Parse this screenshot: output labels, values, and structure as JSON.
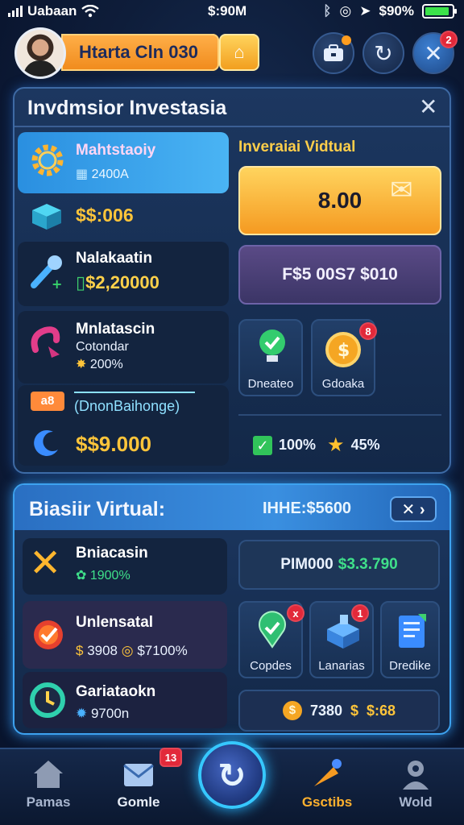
{
  "status_bar": {
    "carrier": "Uabaan",
    "time": "$:90M",
    "battery": "$90%",
    "battery_level": 0.9
  },
  "header": {
    "player_name": "Htarta Cln 030",
    "avatar_icon": "player-portrait",
    "action_icon": "home-icon",
    "buttons": [
      {
        "icon": "toolbox-icon"
      },
      {
        "icon": "refresh-icon"
      },
      {
        "icon": "close-icon",
        "badge": "2"
      }
    ]
  },
  "invest_panel": {
    "title": "Invdmsior Investasia",
    "close_icon": "close-icon",
    "items": [
      {
        "icon": "gear-icon",
        "title": "Mahtstaoiy",
        "sub": "2400A"
      },
      {
        "icon": "box-icon",
        "amount": "$$:006"
      },
      {
        "icon": "wrench-icon",
        "title": "Nalakaatin",
        "amount": "$2,20000"
      },
      {
        "icon": "hook-icon",
        "title": "Mnlatascin",
        "sub": "Cotondar",
        "sub2": "200%"
      },
      {
        "icon": "tag-icon",
        "tag": "a8",
        "title": "(DnonBaihonge)"
      },
      {
        "icon": "moon-icon",
        "amount": "$$9.000"
      }
    ],
    "right_title": "Inveraiai Vidtual",
    "big_button": "8.00",
    "price_button": "F$5 00S7 $010",
    "tiles": [
      {
        "icon": "lightbulb-icon",
        "label": "Dneateo"
      },
      {
        "icon": "coin-icon",
        "label": "Gdoaka",
        "badge": "8"
      }
    ],
    "stats": [
      {
        "icon": "check-icon",
        "value": "100%"
      },
      {
        "icon": "star-icon",
        "value": "45%"
      }
    ]
  },
  "virtual_panel": {
    "title": "Biasiir Virtual:",
    "price_label": "IHHE:$5600",
    "nav_icon": "close-arrow-icon",
    "items": [
      {
        "icon": "cross-icon",
        "title": "Bniacasin",
        "sub": "1900%"
      },
      {
        "icon": "target-icon",
        "title": "Unlensatal",
        "sub": "3908",
        "sub2": "$7100%"
      },
      {
        "icon": "clock-icon",
        "title": "Gariataokn",
        "sub": "9700n"
      }
    ],
    "price_box": "PIM000",
    "price_box_value": "$3.3.790",
    "tiles": [
      {
        "icon": "map-pin-icon",
        "label": "Copdes",
        "badge": "x"
      },
      {
        "icon": "mailbox-icon",
        "label": "Lanarias",
        "badge": "1"
      },
      {
        "icon": "document-icon",
        "label": "Dredike"
      }
    ],
    "footer": [
      {
        "icon": "coin-icon",
        "value": "7380"
      },
      {
        "icon": "dollar-icon",
        "value": "$:68"
      }
    ]
  },
  "bottom_nav": {
    "items": [
      {
        "icon": "home-icon",
        "label": "Pamas"
      },
      {
        "icon": "mail-icon",
        "label": "Gomle",
        "badge": "13"
      },
      {
        "icon": "refresh-icon",
        "label": ""
      },
      {
        "icon": "carrot-icon",
        "label": "Gsctibs"
      },
      {
        "icon": "profile-icon",
        "label": "Wold"
      }
    ]
  },
  "colors": {
    "accent_orange": "#f59a21",
    "accent_gold": "#ffc53a",
    "panel_border": "#3e6aa4",
    "highlight_blue": "#33a7ee",
    "badge_red": "#e2293a"
  }
}
